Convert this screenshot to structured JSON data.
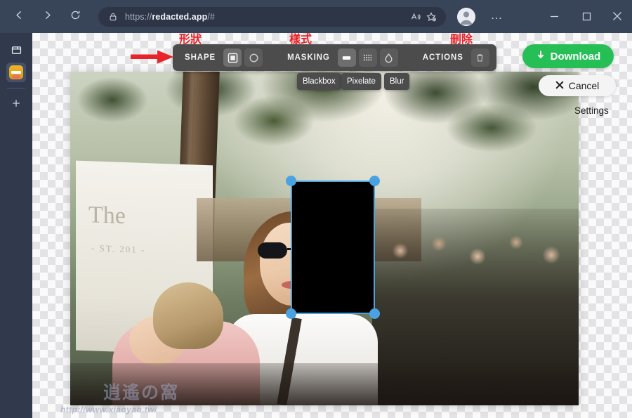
{
  "browser": {
    "nav": {
      "back": "back-arrow",
      "forward": "forward-arrow",
      "reload": "reload"
    },
    "address": {
      "lock_icon": "lock-icon",
      "url_prefix": "https://",
      "url_domain": "redacted.app",
      "url_suffix": "/#",
      "read_aloud_icon": "read-aloud-icon",
      "favorites_icon": "add-favorite-icon"
    },
    "profile_icon": "profile-avatar",
    "more_label": "…",
    "window": {
      "minimize": "—",
      "maximize": "□",
      "close": "✕"
    }
  },
  "sidebar": {
    "tab_collection_icon": "tab-collection-icon",
    "favicon_label": "redacted-app-favicon",
    "add_label": "+"
  },
  "editor": {
    "toolbar": {
      "shape_label": "SHAPE",
      "shape_options": [
        {
          "name": "square",
          "selected": true
        },
        {
          "name": "circle",
          "selected": false
        }
      ],
      "masking_label": "MASKING",
      "masking_options": [
        {
          "name": "blackbox",
          "selected": true
        },
        {
          "name": "pixelate",
          "selected": false
        },
        {
          "name": "blur",
          "selected": false
        }
      ],
      "actions_label": "ACTIONS",
      "actions_options": [
        {
          "name": "delete",
          "icon": "trash-icon"
        }
      ]
    },
    "tooltips": {
      "blackbox": "Blackbox",
      "pixelate": "Pixelate",
      "blur": "Blur"
    },
    "download_label": "Download",
    "download_icon": "download-arrow-icon",
    "download_color": "#26bf56",
    "cancel_label": "Cancel",
    "cancel_icon": "close-x-icon",
    "settings_label": "Settings",
    "selection": {
      "shape": "rectangle",
      "fill": "#000000",
      "handle_color": "#4aa3e0",
      "handles": 4
    }
  },
  "annotations": {
    "shape": "形狀",
    "style": "樣式",
    "delete": "刪除",
    "arrow_color": "#e8232a"
  },
  "watermark": {
    "title": "逍遙の窩",
    "url": "http://www.xiaoyao.tw/"
  }
}
